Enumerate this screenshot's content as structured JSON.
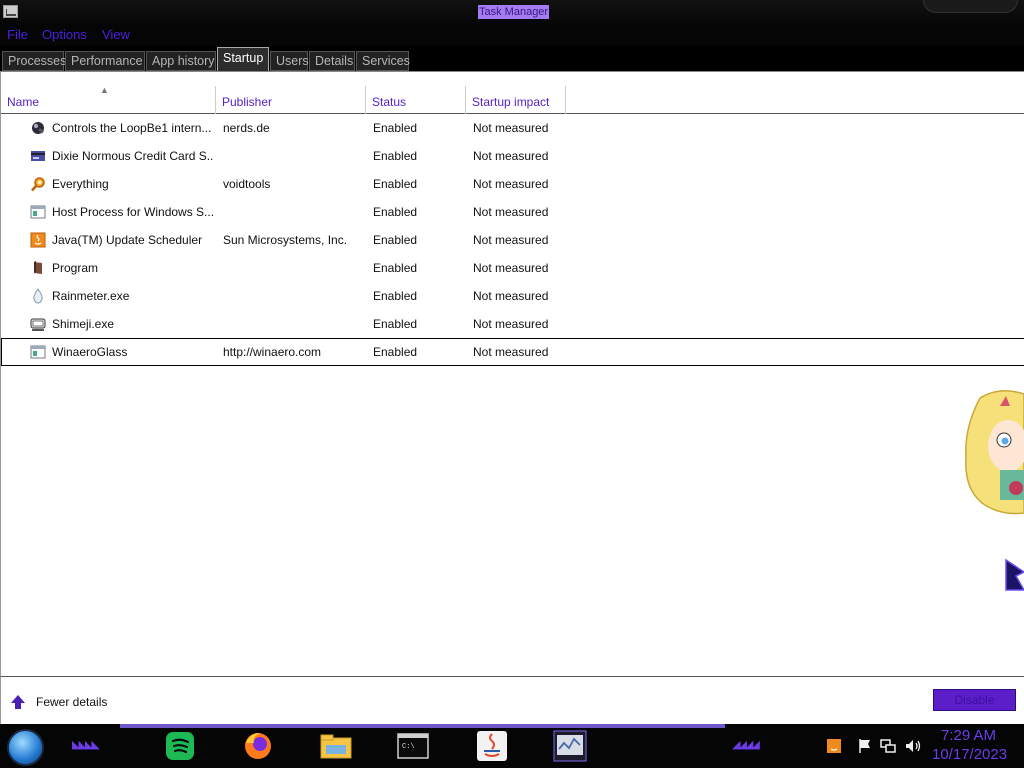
{
  "window": {
    "title": "Task Manager"
  },
  "menu": {
    "items": [
      "File",
      "Options",
      "View"
    ]
  },
  "tabs": [
    "Processes",
    "Performance",
    "App history",
    "Startup",
    "Users",
    "Details",
    "Services"
  ],
  "active_tab": "Startup",
  "table": {
    "columns": [
      "Name",
      "Publisher",
      "Status",
      "Startup impact"
    ],
    "sort_column": "Name",
    "rows": [
      {
        "icon": "loopbe-icon",
        "name": "Controls the LoopBe1 intern...",
        "publisher": "nerds.de",
        "status": "Enabled",
        "impact": "Not measured"
      },
      {
        "icon": "credit-card-icon",
        "name": "Dixie Normous Credit Card S...",
        "publisher": "",
        "status": "Enabled",
        "impact": "Not measured"
      },
      {
        "icon": "magnifier-icon",
        "name": "Everything",
        "publisher": "voidtools",
        "status": "Enabled",
        "impact": "Not measured"
      },
      {
        "icon": "window-icon",
        "name": "Host Process for Windows S...",
        "publisher": "",
        "status": "Enabled",
        "impact": "Not measured"
      },
      {
        "icon": "java-icon",
        "name": "Java(TM) Update Scheduler",
        "publisher": "Sun Microsystems, Inc.",
        "status": "Enabled",
        "impact": "Not measured"
      },
      {
        "icon": "program-icon",
        "name": "Program",
        "publisher": "",
        "status": "Enabled",
        "impact": "Not measured"
      },
      {
        "icon": "raindrop-icon",
        "name": "Rainmeter.exe",
        "publisher": "",
        "status": "Enabled",
        "impact": "Not measured"
      },
      {
        "icon": "shimeji-icon",
        "name": "Shimeji.exe",
        "publisher": "",
        "status": "Enabled",
        "impact": "Not measured"
      },
      {
        "icon": "window-icon",
        "name": "WinaeroGlass",
        "publisher": "http://winaero.com",
        "status": "Enabled",
        "impact": "Not measured"
      }
    ],
    "selected_row": "WinaeroGlass"
  },
  "footer": {
    "fewer_details": "Fewer details",
    "disable_button": "Disable"
  },
  "taskbar": {
    "apps": [
      "spotify-icon",
      "firefox-icon",
      "file-explorer-icon",
      "command-prompt-icon",
      "java-icon",
      "task-manager-icon"
    ],
    "tray_icons": [
      "java-update-icon",
      "flag-icon",
      "network-icon",
      "volume-icon"
    ],
    "clock_time": "7:29 AM",
    "clock_date": "10/17/2023"
  },
  "colors": {
    "accent": "#5521c8",
    "title_highlight": "#a37cf3",
    "taskbar_text": "#6a3de8"
  }
}
